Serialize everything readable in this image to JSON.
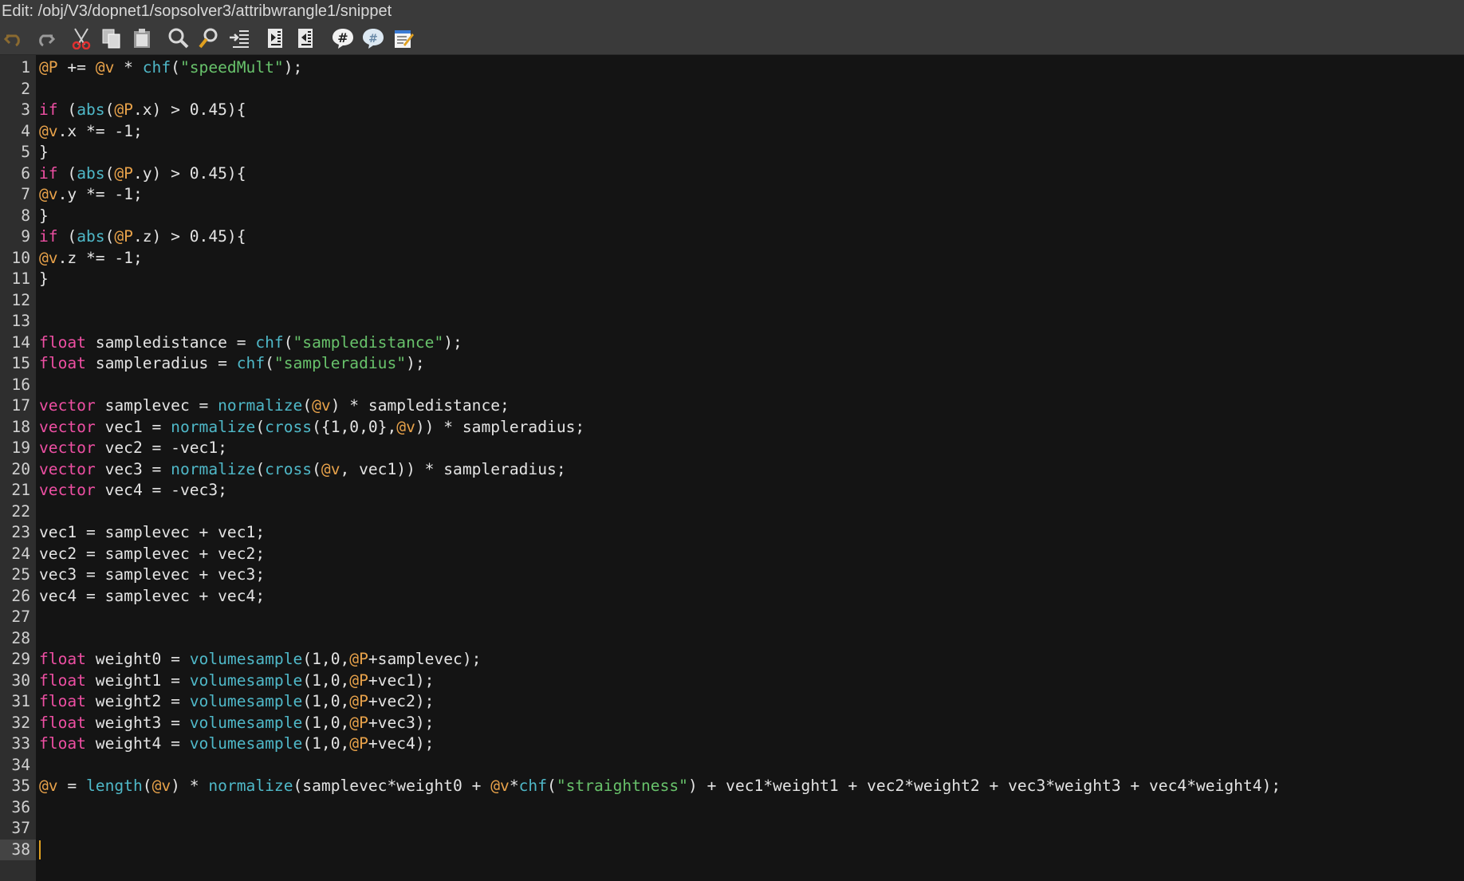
{
  "window": {
    "title": "Edit: /obj/V3/dopnet1/sopsolver3/attribwrangle1/snippet"
  },
  "toolbar": {
    "buttons": [
      {
        "name": "undo",
        "icon": "undo-icon"
      },
      {
        "name": "redo",
        "icon": "redo-icon"
      },
      {
        "name": "cut",
        "icon": "scissors-icon"
      },
      {
        "name": "copy",
        "icon": "copy-icon"
      },
      {
        "name": "paste",
        "icon": "clipboard-icon"
      },
      {
        "name": "find",
        "icon": "magnifier-icon"
      },
      {
        "name": "find-replace",
        "icon": "search-replace-icon"
      },
      {
        "name": "goto-line",
        "icon": "goto-line-icon"
      },
      {
        "name": "indent",
        "icon": "indent-icon"
      },
      {
        "name": "unindent",
        "icon": "unindent-icon"
      },
      {
        "name": "comment",
        "icon": "comment-hash-icon"
      },
      {
        "name": "uncomment",
        "icon": "uncomment-bubble-icon"
      },
      {
        "name": "external-editor",
        "icon": "notepad-icon"
      }
    ]
  },
  "editor": {
    "active_line": 38,
    "lines": [
      [
        [
          "at",
          "@P"
        ],
        [
          "t",
          " += "
        ],
        [
          "at",
          "@v"
        ],
        [
          "t",
          " * "
        ],
        [
          "fn",
          "chf"
        ],
        [
          "t",
          "("
        ],
        [
          "str",
          "\"speedMult\""
        ],
        [
          "t",
          ");"
        ]
      ],
      [],
      [
        [
          "kw",
          "if"
        ],
        [
          "t",
          " ("
        ],
        [
          "fn",
          "abs"
        ],
        [
          "t",
          "("
        ],
        [
          "at",
          "@P"
        ],
        [
          "t",
          ".x) > 0.45){"
        ]
      ],
      [
        [
          "at",
          "@v"
        ],
        [
          "t",
          ".x *= -1;"
        ]
      ],
      [
        [
          "t",
          "}"
        ]
      ],
      [
        [
          "kw",
          "if"
        ],
        [
          "t",
          " ("
        ],
        [
          "fn",
          "abs"
        ],
        [
          "t",
          "("
        ],
        [
          "at",
          "@P"
        ],
        [
          "t",
          ".y) > 0.45){"
        ]
      ],
      [
        [
          "at",
          "@v"
        ],
        [
          "t",
          ".y *= -1;"
        ]
      ],
      [
        [
          "t",
          "}"
        ]
      ],
      [
        [
          "kw",
          "if"
        ],
        [
          "t",
          " ("
        ],
        [
          "fn",
          "abs"
        ],
        [
          "t",
          "("
        ],
        [
          "at",
          "@P"
        ],
        [
          "t",
          ".z) > 0.45){"
        ]
      ],
      [
        [
          "at",
          "@v"
        ],
        [
          "t",
          ".z *= -1;"
        ]
      ],
      [
        [
          "t",
          "}"
        ]
      ],
      [],
      [],
      [
        [
          "kw",
          "float"
        ],
        [
          "t",
          " sampledistance = "
        ],
        [
          "fn",
          "chf"
        ],
        [
          "t",
          "("
        ],
        [
          "str",
          "\"sampledistance\""
        ],
        [
          "t",
          ");"
        ]
      ],
      [
        [
          "kw",
          "float"
        ],
        [
          "t",
          " sampleradius = "
        ],
        [
          "fn",
          "chf"
        ],
        [
          "t",
          "("
        ],
        [
          "str",
          "\"sampleradius\""
        ],
        [
          "t",
          ");"
        ]
      ],
      [],
      [
        [
          "kw",
          "vector"
        ],
        [
          "t",
          " samplevec = "
        ],
        [
          "fn",
          "normalize"
        ],
        [
          "t",
          "("
        ],
        [
          "at",
          "@v"
        ],
        [
          "t",
          ") * sampledistance;"
        ]
      ],
      [
        [
          "kw",
          "vector"
        ],
        [
          "t",
          " vec1 = "
        ],
        [
          "fn",
          "normalize"
        ],
        [
          "t",
          "("
        ],
        [
          "fn",
          "cross"
        ],
        [
          "t",
          "({1,0,0},"
        ],
        [
          "at",
          "@v"
        ],
        [
          "t",
          ")) * sampleradius;"
        ]
      ],
      [
        [
          "kw",
          "vector"
        ],
        [
          "t",
          " vec2 = -vec1;"
        ]
      ],
      [
        [
          "kw",
          "vector"
        ],
        [
          "t",
          " vec3 = "
        ],
        [
          "fn",
          "normalize"
        ],
        [
          "t",
          "("
        ],
        [
          "fn",
          "cross"
        ],
        [
          "t",
          "("
        ],
        [
          "at",
          "@v"
        ],
        [
          "t",
          ", vec1)) * sampleradius;"
        ]
      ],
      [
        [
          "kw",
          "vector"
        ],
        [
          "t",
          " vec4 = -vec3;"
        ]
      ],
      [],
      [
        [
          "t",
          "vec1 = samplevec + vec1;"
        ]
      ],
      [
        [
          "t",
          "vec2 = samplevec + vec2;"
        ]
      ],
      [
        [
          "t",
          "vec3 = samplevec + vec3;"
        ]
      ],
      [
        [
          "t",
          "vec4 = samplevec + vec4;"
        ]
      ],
      [],
      [],
      [
        [
          "kw",
          "float"
        ],
        [
          "t",
          " weight0 = "
        ],
        [
          "fn",
          "volumesample"
        ],
        [
          "t",
          "(1,0,"
        ],
        [
          "at",
          "@P"
        ],
        [
          "t",
          "+samplevec);"
        ]
      ],
      [
        [
          "kw",
          "float"
        ],
        [
          "t",
          " weight1 = "
        ],
        [
          "fn",
          "volumesample"
        ],
        [
          "t",
          "(1,0,"
        ],
        [
          "at",
          "@P"
        ],
        [
          "t",
          "+vec1);"
        ]
      ],
      [
        [
          "kw",
          "float"
        ],
        [
          "t",
          " weight2 = "
        ],
        [
          "fn",
          "volumesample"
        ],
        [
          "t",
          "(1,0,"
        ],
        [
          "at",
          "@P"
        ],
        [
          "t",
          "+vec2);"
        ]
      ],
      [
        [
          "kw",
          "float"
        ],
        [
          "t",
          " weight3 = "
        ],
        [
          "fn",
          "volumesample"
        ],
        [
          "t",
          "(1,0,"
        ],
        [
          "at",
          "@P"
        ],
        [
          "t",
          "+vec3);"
        ]
      ],
      [
        [
          "kw",
          "float"
        ],
        [
          "t",
          " weight4 = "
        ],
        [
          "fn",
          "volumesample"
        ],
        [
          "t",
          "(1,0,"
        ],
        [
          "at",
          "@P"
        ],
        [
          "t",
          "+vec4);"
        ]
      ],
      [],
      [
        [
          "at",
          "@v"
        ],
        [
          "t",
          " = "
        ],
        [
          "fn",
          "length"
        ],
        [
          "t",
          "("
        ],
        [
          "at",
          "@v"
        ],
        [
          "t",
          ") * "
        ],
        [
          "fn",
          "normalize"
        ],
        [
          "t",
          "(samplevec*weight0 + "
        ],
        [
          "at",
          "@v"
        ],
        [
          "t",
          "*"
        ],
        [
          "fn",
          "chf"
        ],
        [
          "t",
          "("
        ],
        [
          "str",
          "\"straightness\""
        ],
        [
          "t",
          ") + vec1*weight1 + vec2*weight2 + vec3*weight3 + vec4*weight4);"
        ]
      ],
      [],
      [],
      []
    ]
  },
  "colors": {
    "keyword": "#ee4fa3",
    "function": "#4fb8c8",
    "attribute": "#e8a24a",
    "string": "#68c26b",
    "text": "#e4e4e4",
    "background": "#141414",
    "gutter": "#2e2e2e",
    "caret": "#e0a020"
  }
}
